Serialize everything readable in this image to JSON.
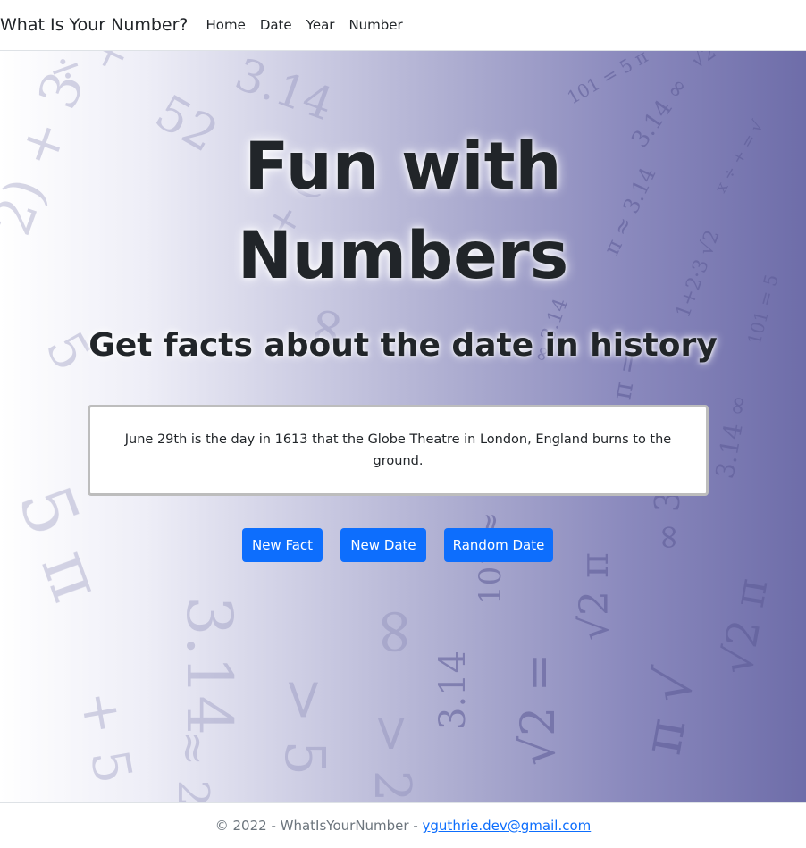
{
  "navbar": {
    "brand": "What Is Your Number?",
    "links": [
      "Home",
      "Date",
      "Year",
      "Number"
    ]
  },
  "hero": {
    "title_line1": "Fun with",
    "title_line2": "Numbers",
    "subtitle": "Get facts about the date in history",
    "fact": "June 29th is the day in 1613 that the Globe Theatre in London, England burns to the ground."
  },
  "buttons": {
    "new_fact": "New Fact",
    "new_date": "New Date",
    "random_date": "Random Date"
  },
  "footer": {
    "text": "© 2022 - WhatIsYourNumber - ",
    "email": "yguthrie.dev@gmail.com"
  },
  "colors": {
    "primary": "#0d6efd",
    "hero_gradient_end": "#6e6da9"
  }
}
